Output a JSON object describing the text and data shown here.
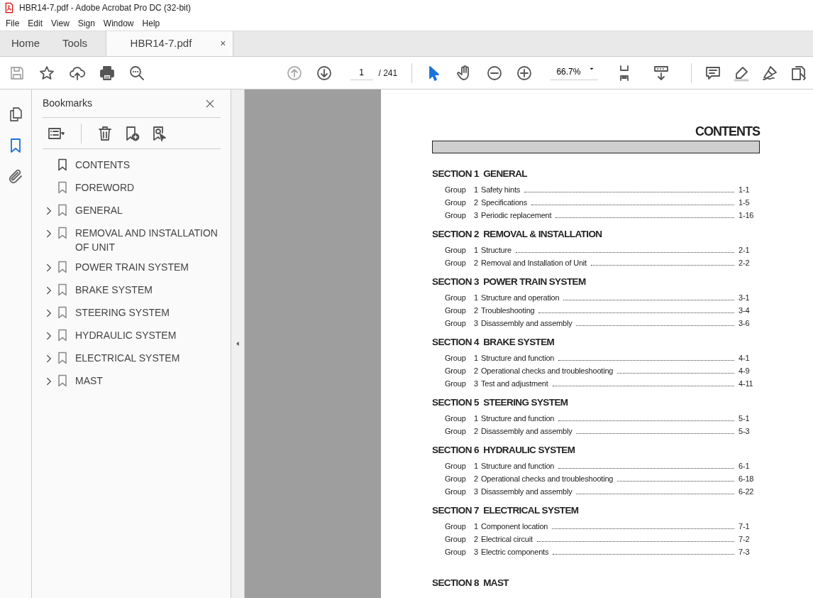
{
  "window": {
    "title": "HBR14-7.pdf - Adobe Acrobat Pro DC (32-bit)"
  },
  "menu": [
    "File",
    "Edit",
    "View",
    "Sign",
    "Window",
    "Help"
  ],
  "tabs": [
    {
      "label": "Home",
      "selected": false
    },
    {
      "label": "Tools",
      "selected": false
    },
    {
      "label": "HBR14-7.pdf",
      "selected": true,
      "close": "×"
    }
  ],
  "toolbar": {
    "page": "1",
    "page_total": "/ 241",
    "zoom": "66.7%"
  },
  "rail": [
    {
      "kind": "pages",
      "selected": false
    },
    {
      "kind": "bookmarks",
      "selected": true
    },
    {
      "kind": "attachments",
      "selected": false
    }
  ],
  "bookmarks": {
    "title": "Bookmarks",
    "items": [
      {
        "label": "CONTENTS",
        "expandable": false,
        "selected": true
      },
      {
        "label": "FOREWORD",
        "expandable": false,
        "selected": false
      },
      {
        "label": "GENERAL",
        "expandable": true,
        "selected": false
      },
      {
        "label": "REMOVAL AND INSTALLATION OF UNIT",
        "expandable": true,
        "selected": false
      },
      {
        "label": "POWER TRAIN SYSTEM",
        "expandable": true,
        "selected": false
      },
      {
        "label": "BRAKE SYSTEM",
        "expandable": true,
        "selected": false
      },
      {
        "label": "STEERING SYSTEM",
        "expandable": true,
        "selected": false
      },
      {
        "label": "HYDRAULIC SYSTEM",
        "expandable": true,
        "selected": false
      },
      {
        "label": "ELECTRICAL SYSTEM",
        "expandable": true,
        "selected": false
      },
      {
        "label": "MAST",
        "expandable": true,
        "selected": false
      }
    ]
  },
  "document": {
    "title": "CONTENTS",
    "sections": [
      {
        "heading": "SECTION 1  GENERAL",
        "groups": [
          {
            "label": "Group",
            "number": "1",
            "title": "Safety hints",
            "page": "1-1"
          },
          {
            "label": "Group",
            "number": "2",
            "title": "Specifications",
            "page": "1-5"
          },
          {
            "label": "Group",
            "number": "3",
            "title": "Periodic replacement",
            "page": "1-16"
          }
        ]
      },
      {
        "heading": "SECTION 2  REMOVAL & INSTALLATION",
        "groups": [
          {
            "label": "Group",
            "number": "1",
            "title": "Structure",
            "page": "2-1"
          },
          {
            "label": "Group",
            "number": "2",
            "title": "Removal and Installation of Unit",
            "page": "2-2"
          }
        ]
      },
      {
        "heading": "SECTION 3  POWER TRAIN SYSTEM",
        "groups": [
          {
            "label": "Group",
            "number": "1",
            "title": "Structure and operation",
            "page": "3-1"
          },
          {
            "label": "Group",
            "number": "2",
            "title": "Troubleshooting",
            "page": "3-4"
          },
          {
            "label": "Group",
            "number": "3",
            "title": "Disassembly and assembly",
            "page": "3-6"
          }
        ]
      },
      {
        "heading": "SECTION 4  BRAKE SYSTEM",
        "groups": [
          {
            "label": "Group",
            "number": "1",
            "title": "Structure and function",
            "page": "4-1"
          },
          {
            "label": "Group",
            "number": "2",
            "title": "Operational checks and troubleshooting",
            "page": "4-9"
          },
          {
            "label": "Group",
            "number": "3",
            "title": "Test and adjustment",
            "page": "4-11"
          }
        ]
      },
      {
        "heading": "SECTION 5  STEERING SYSTEM",
        "groups": [
          {
            "label": "Group",
            "number": "1",
            "title": "Structure and function",
            "page": "5-1"
          },
          {
            "label": "Group",
            "number": "2",
            "title": "Disassembly and assembly",
            "page": "5-3"
          }
        ]
      },
      {
        "heading": "SECTION 6  HYDRAULIC SYSTEM",
        "groups": [
          {
            "label": "Group",
            "number": "1",
            "title": "Structure and function",
            "page": "6-1"
          },
          {
            "label": "Group",
            "number": "2",
            "title": "Operational checks and troubleshooting",
            "page": "6-18"
          },
          {
            "label": "Group",
            "number": "3",
            "title": "Disassembly and assembly",
            "page": "6-22"
          }
        ]
      },
      {
        "heading": "SECTION 7  ELECTRICAL SYSTEM",
        "groups": [
          {
            "label": "Group",
            "number": "1",
            "title": "Component location",
            "page": "7-1"
          },
          {
            "label": "Group",
            "number": "2",
            "title": "Electrical circuit",
            "page": "7-2"
          },
          {
            "label": "Group",
            "number": "3",
            "title": "Electric components",
            "page": "7-3"
          }
        ]
      },
      {
        "heading": "SECTION 8  MAST"
      }
    ]
  }
}
